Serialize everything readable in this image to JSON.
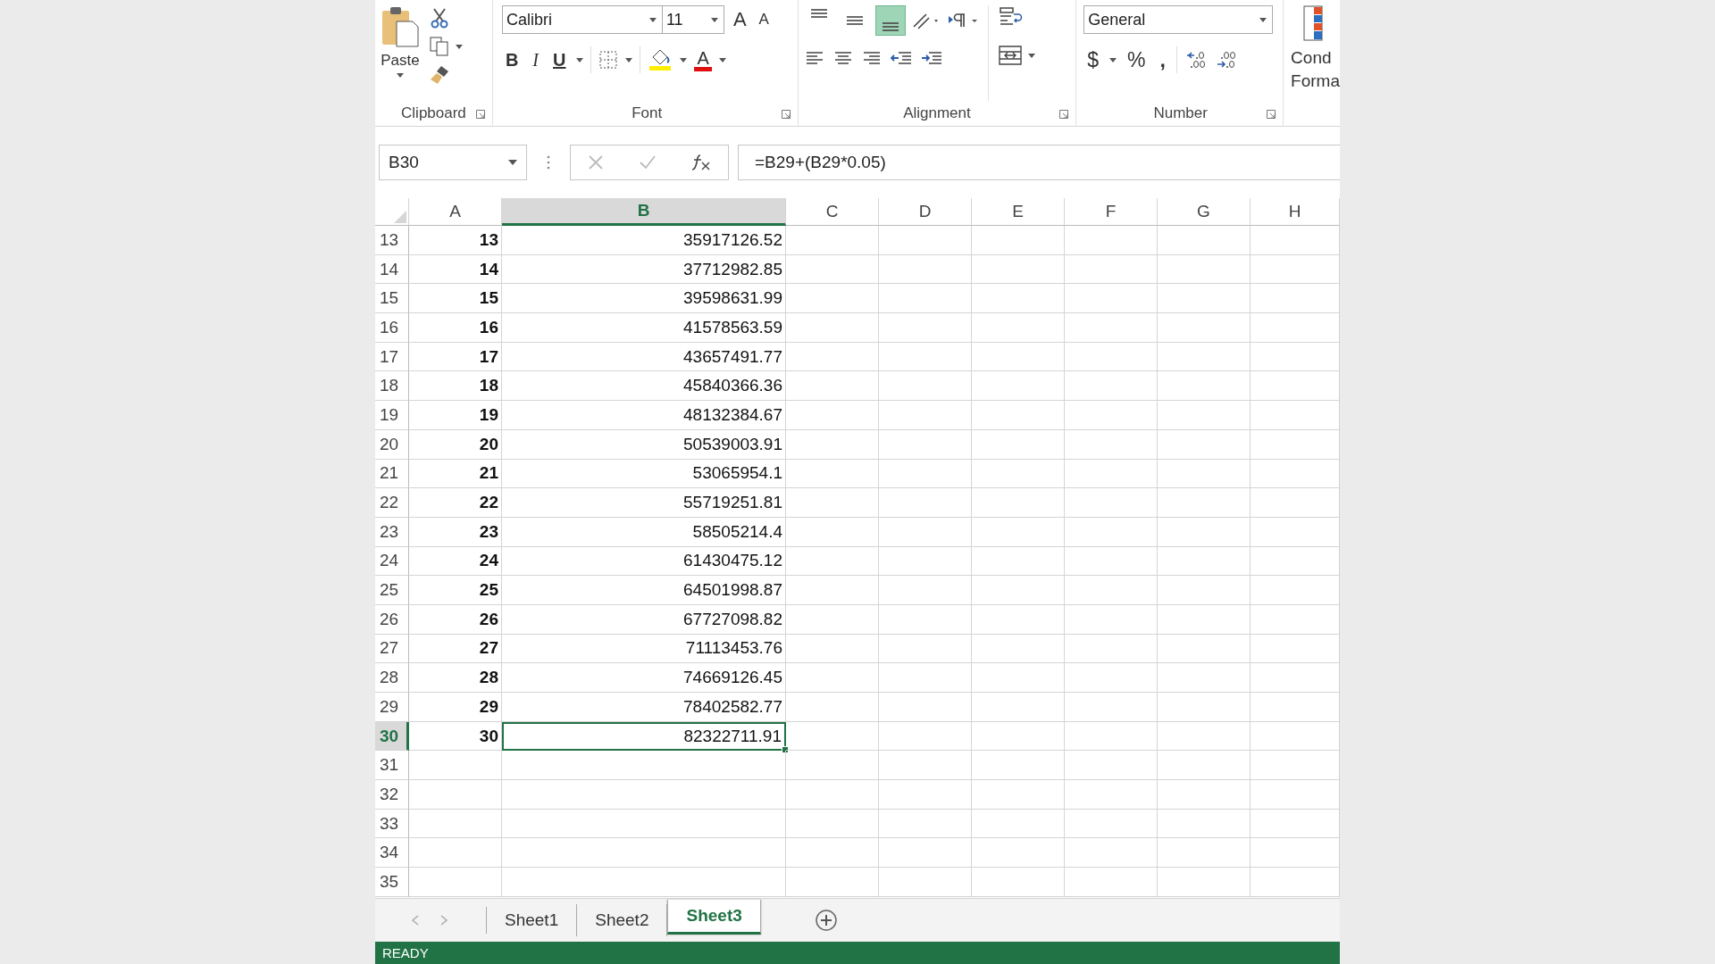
{
  "ribbon": {
    "clipboard": {
      "label": "Clipboard",
      "paste": "Paste"
    },
    "font": {
      "label": "Font",
      "name": "Calibri",
      "size": "11",
      "grow": "A",
      "shrink": "A",
      "bold": "B",
      "italic": "I",
      "underline": "U",
      "color_letter": "A"
    },
    "alignment": {
      "label": "Alignment",
      "vertical": [
        {
          "kind": "top",
          "selected": false
        },
        {
          "kind": "middle",
          "selected": false
        },
        {
          "kind": "bottom",
          "selected": true
        }
      ]
    },
    "number": {
      "label": "Number",
      "format": "General",
      "currency": "$",
      "percent": "%",
      "comma": ","
    },
    "styles": {
      "conditional_formatting": [
        "Cond",
        "Forma"
      ]
    }
  },
  "name_box": "B30",
  "formula": "=B29+(B29*0.05)",
  "columns": [
    {
      "label": "A",
      "selected": false
    },
    {
      "label": "B",
      "selected": true
    },
    {
      "label": "C",
      "selected": false
    },
    {
      "label": "D",
      "selected": false
    },
    {
      "label": "E",
      "selected": false
    },
    {
      "label": "F",
      "selected": false
    },
    {
      "label": "G",
      "selected": false
    },
    {
      "label": "H",
      "selected": false
    }
  ],
  "rows": [
    {
      "number": "13",
      "a": "13",
      "b": "35917126.52",
      "selected": false
    },
    {
      "number": "14",
      "a": "14",
      "b": "37712982.85",
      "selected": false
    },
    {
      "number": "15",
      "a": "15",
      "b": "39598631.99",
      "selected": false
    },
    {
      "number": "16",
      "a": "16",
      "b": "41578563.59",
      "selected": false
    },
    {
      "number": "17",
      "a": "17",
      "b": "43657491.77",
      "selected": false
    },
    {
      "number": "18",
      "a": "18",
      "b": "45840366.36",
      "selected": false
    },
    {
      "number": "19",
      "a": "19",
      "b": "48132384.67",
      "selected": false
    },
    {
      "number": "20",
      "a": "20",
      "b": "50539003.91",
      "selected": false
    },
    {
      "number": "21",
      "a": "21",
      "b": "53065954.1",
      "selected": false
    },
    {
      "number": "22",
      "a": "22",
      "b": "55719251.81",
      "selected": false
    },
    {
      "number": "23",
      "a": "23",
      "b": "58505214.4",
      "selected": false
    },
    {
      "number": "24",
      "a": "24",
      "b": "61430475.12",
      "selected": false
    },
    {
      "number": "25",
      "a": "25",
      "b": "64501998.87",
      "selected": false
    },
    {
      "number": "26",
      "a": "26",
      "b": "67727098.82",
      "selected": false
    },
    {
      "number": "27",
      "a": "27",
      "b": "71113453.76",
      "selected": false
    },
    {
      "number": "28",
      "a": "28",
      "b": "74669126.45",
      "selected": false
    },
    {
      "number": "29",
      "a": "29",
      "b": "78402582.77",
      "selected": false
    },
    {
      "number": "30",
      "a": "30",
      "b": "82322711.91",
      "selected": true
    },
    {
      "number": "31",
      "selected": false
    },
    {
      "number": "32",
      "selected": false
    },
    {
      "number": "33",
      "selected": false
    },
    {
      "number": "34",
      "selected": false
    },
    {
      "number": "35",
      "selected": false
    }
  ],
  "sheets": [
    {
      "label": "Sheet1",
      "selected": false
    },
    {
      "label": "Sheet2",
      "selected": false
    },
    {
      "label": "Sheet3",
      "selected": true
    }
  ],
  "status": "READY"
}
